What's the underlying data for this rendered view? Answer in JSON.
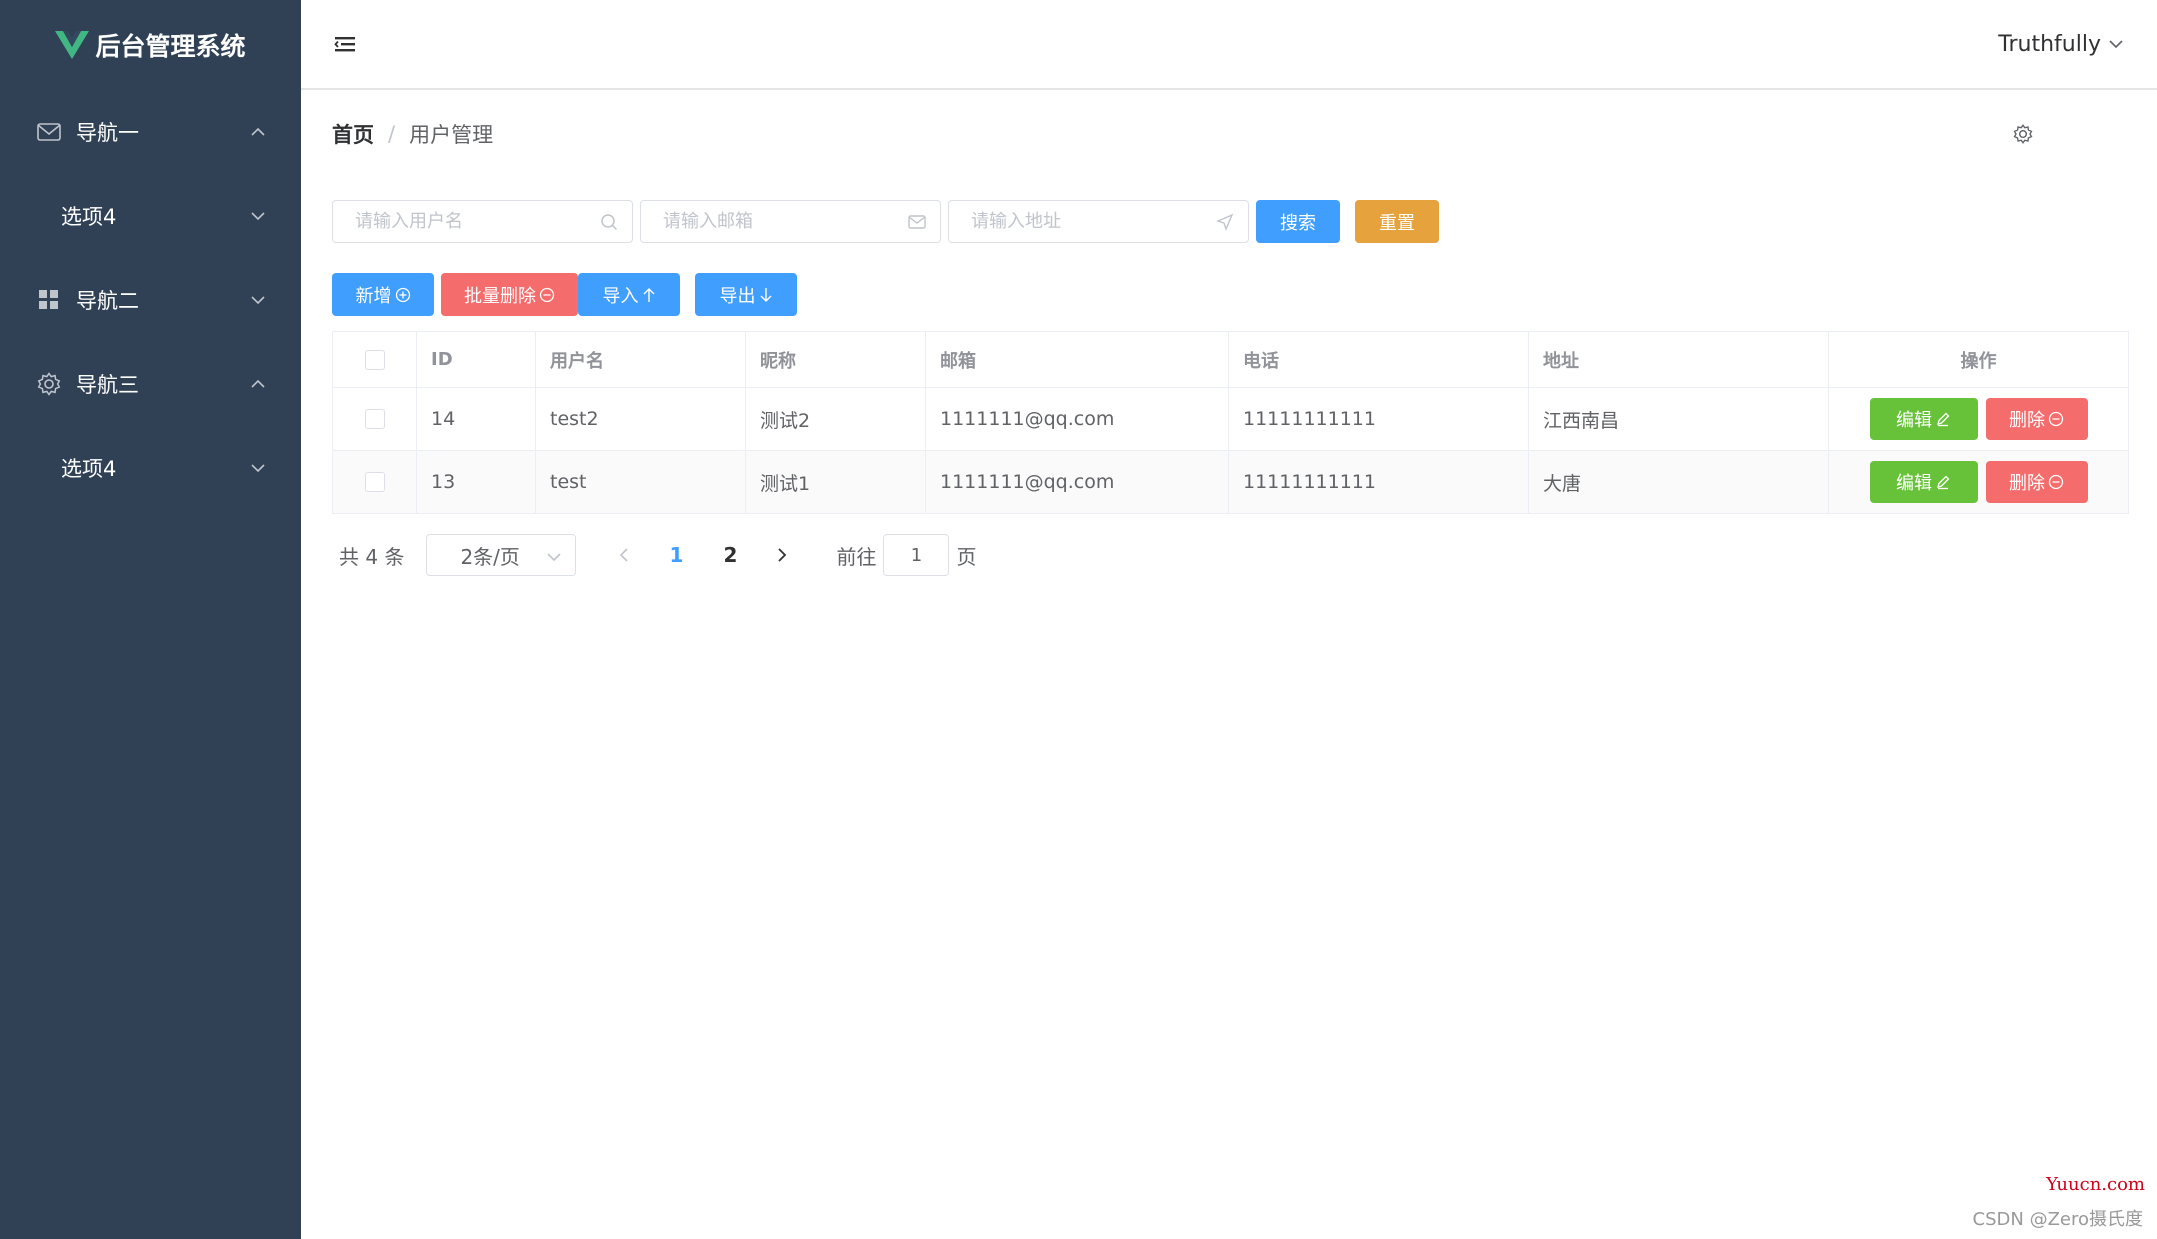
{
  "app": {
    "title": "后台管理系统"
  },
  "sidebar": {
    "items": [
      {
        "label": "导航一",
        "icon": "message-icon",
        "expanded": true
      },
      {
        "label": "选项4",
        "icon": "",
        "expanded": false
      },
      {
        "label": "导航二",
        "icon": "menu-grid-icon",
        "expanded": false
      },
      {
        "label": "导航三",
        "icon": "setting-icon",
        "expanded": true
      },
      {
        "label": "选项4",
        "icon": "",
        "expanded": false
      }
    ]
  },
  "header": {
    "username": "Truthfully"
  },
  "breadcrumb": {
    "home": "首页",
    "separator": "/",
    "current": "用户管理"
  },
  "search": {
    "username_placeholder": "请输入用户名",
    "email_placeholder": "请输入邮箱",
    "address_placeholder": "请输入地址",
    "search_label": "搜索",
    "reset_label": "重置"
  },
  "toolbar": {
    "add_label": "新增",
    "batch_delete_label": "批量删除",
    "import_label": "导入",
    "export_label": "导出"
  },
  "table": {
    "columns": [
      "ID",
      "用户名",
      "昵称",
      "邮箱",
      "电话",
      "地址",
      "操作"
    ],
    "rows": [
      {
        "id": "14",
        "username": "test2",
        "nickname": "测试2",
        "email": "1111111@qq.com",
        "phone": "11111111111",
        "address": "江西南昌"
      },
      {
        "id": "13",
        "username": "test",
        "nickname": "测试1",
        "email": "1111111@qq.com",
        "phone": "11111111111",
        "address": "大唐"
      }
    ],
    "edit_label": "编辑",
    "delete_label": "删除"
  },
  "pagination": {
    "total_text": "共 4 条",
    "page_size": "2条/页",
    "pages": [
      "1",
      "2"
    ],
    "current_page": "1",
    "goto_prefix": "前往",
    "goto_value": "1",
    "goto_suffix": "页"
  },
  "watermarks": {
    "site": "Yuucn.com",
    "author": "CSDN @Zero摄氏度"
  },
  "colors": {
    "sidebar_bg": "#304156",
    "primary": "#409eff",
    "warning": "#e6a23c",
    "danger": "#f56c6c",
    "success": "#67c23a"
  }
}
